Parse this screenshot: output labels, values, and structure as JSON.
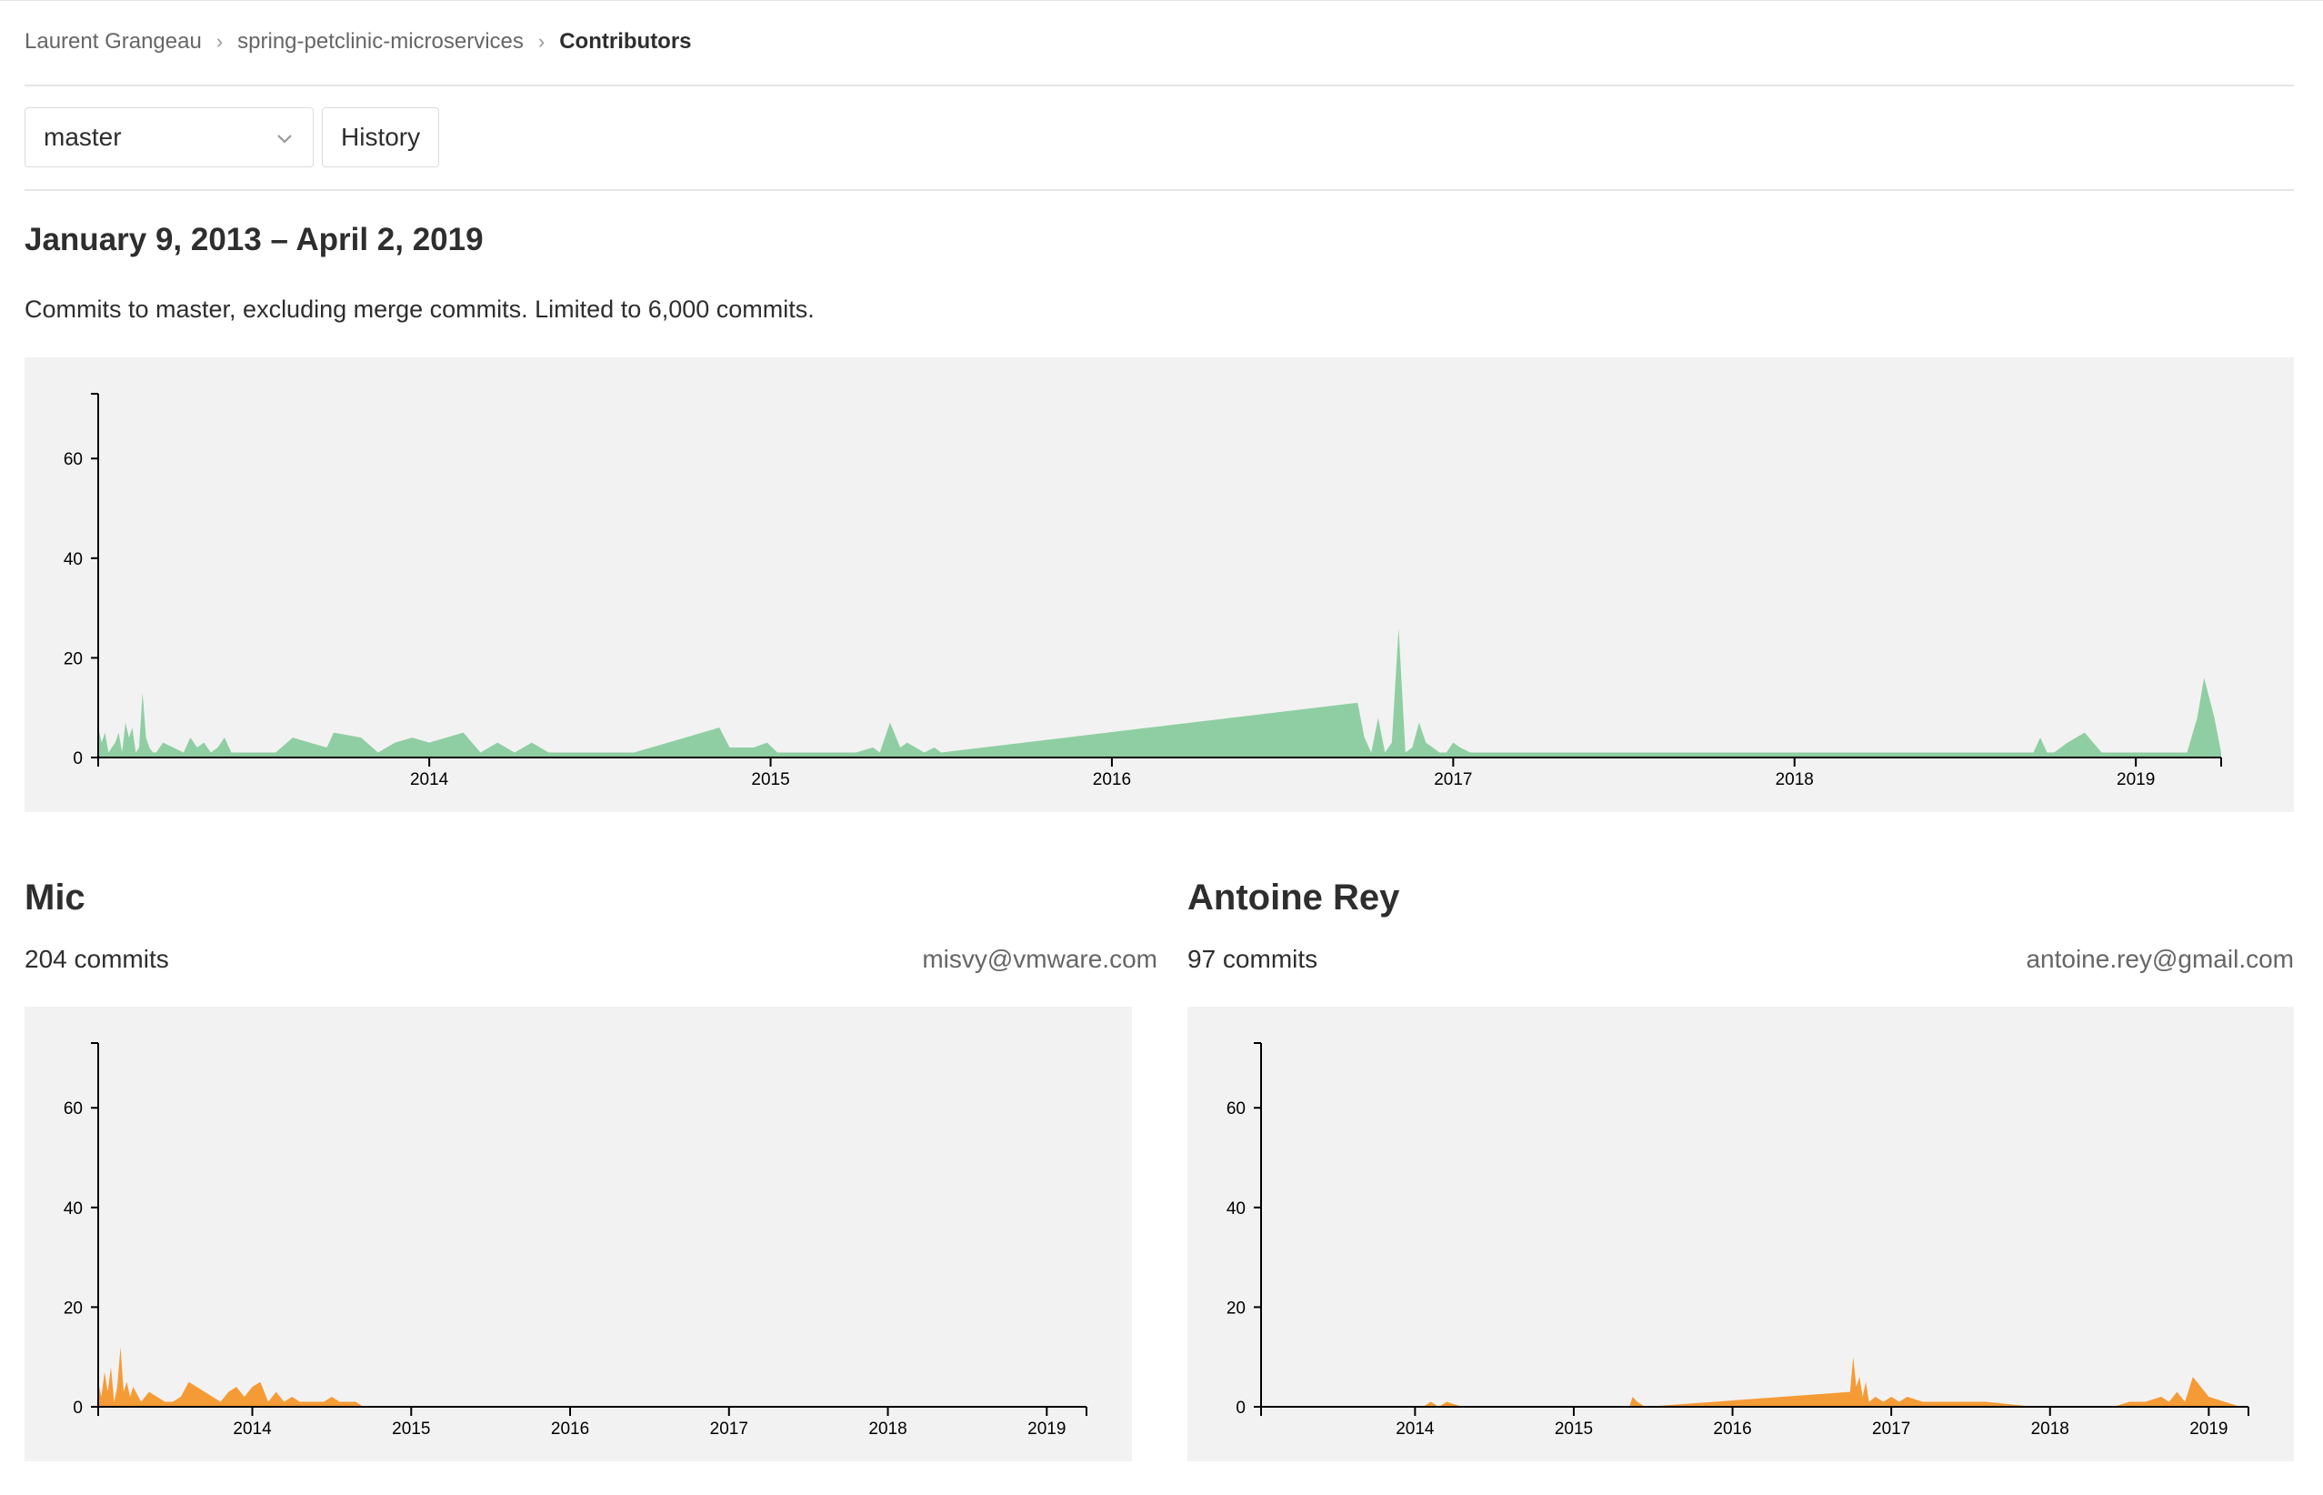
{
  "breadcrumb": {
    "items": [
      "Laurent Grangeau",
      "spring-petclinic-microservices"
    ],
    "current": "Contributors"
  },
  "controls": {
    "branch": "master",
    "history_label": "History"
  },
  "range_title": "January 9, 2013 – April 2, 2019",
  "description": "Commits to master, excluding merge commits. Limited to 6,000 commits.",
  "colors": {
    "overall": "#8fcea2",
    "contributor": "#f59b36",
    "chart_bg": "#f2f2f2"
  },
  "chart_data": [
    {
      "type": "area",
      "ylim": [
        0,
        73
      ],
      "yticks": [
        0,
        20,
        40,
        60
      ],
      "xlim": [
        2013.03,
        2019.25
      ],
      "xticks": [
        "2014",
        "2015",
        "2016",
        "2017",
        "2018",
        "2019"
      ],
      "series": [
        {
          "x": [
            2013.03,
            2013.04,
            2013.05,
            2013.06,
            2013.07,
            2013.08,
            2013.09,
            2013.1,
            2013.11,
            2013.12,
            2013.13,
            2013.14,
            2013.15,
            2013.16,
            2013.17,
            2013.18,
            2013.19,
            2013.2,
            2013.22,
            2013.25,
            2013.28,
            2013.3,
            2013.32,
            2013.34,
            2013.36,
            2013.38,
            2013.4,
            2013.42,
            2013.45,
            2013.47,
            2013.5,
            2013.55,
            2013.6,
            2013.65,
            2013.7,
            2013.72,
            2013.8,
            2013.85,
            2013.9,
            2013.95,
            2014.0,
            2014.1,
            2014.15,
            2014.2,
            2014.25,
            2014.3,
            2014.35,
            2014.4,
            2014.6,
            2014.75,
            2014.85,
            2014.88,
            2014.95,
            2014.99,
            2015.02,
            2015.05,
            2015.1,
            2015.2,
            2015.25,
            2015.3,
            2015.32,
            2015.35,
            2015.38,
            2015.4,
            2015.45,
            2015.48,
            2015.5,
            2016.72,
            2016.74,
            2016.76,
            2016.78,
            2016.8,
            2016.82,
            2016.84,
            2016.86,
            2016.88,
            2016.9,
            2016.92,
            2016.94,
            2016.96,
            2016.98,
            2017.0,
            2017.02,
            2017.05,
            2018.7,
            2018.72,
            2018.74,
            2018.76,
            2018.8,
            2018.85,
            2018.9,
            2019.05,
            2019.1,
            2019.15,
            2019.18,
            2019.2,
            2019.23,
            2019.25
          ],
          "y": [
            6,
            3,
            5,
            1,
            2,
            3,
            5,
            1,
            7,
            4,
            6,
            1,
            2,
            13,
            4,
            2,
            1,
            1,
            3,
            2,
            1,
            4,
            2,
            3,
            1,
            2,
            4,
            1,
            1,
            1,
            1,
            1,
            4,
            3,
            2,
            5,
            4,
            1,
            3,
            4,
            3,
            5,
            1,
            3,
            1,
            3,
            1,
            1,
            1,
            4,
            6,
            2,
            2,
            3,
            1,
            1,
            1,
            1,
            1,
            2,
            1,
            7,
            2,
            3,
            1,
            2,
            1,
            11,
            4,
            1,
            8,
            1,
            3,
            26,
            1,
            2,
            7,
            3,
            2,
            1,
            1,
            3,
            2,
            1,
            1,
            4,
            1,
            1,
            3,
            5,
            1,
            1,
            1,
            1,
            8,
            16,
            8,
            1
          ]
        }
      ]
    },
    {
      "type": "area",
      "title": "Mic",
      "ylim": [
        0,
        73
      ],
      "yticks": [
        0,
        20,
        40,
        60
      ],
      "xlim": [
        2013.03,
        2019.25
      ],
      "xticks": [
        "2014",
        "2015",
        "2016",
        "2017",
        "2018",
        "2019"
      ],
      "series": [
        {
          "x": [
            2013.03,
            2013.05,
            2013.07,
            2013.09,
            2013.11,
            2013.13,
            2013.15,
            2013.17,
            2013.19,
            2013.21,
            2013.23,
            2013.25,
            2013.3,
            2013.35,
            2013.4,
            2013.45,
            2013.5,
            2013.55,
            2013.6,
            2013.65,
            2013.7,
            2013.75,
            2013.8,
            2013.85,
            2013.9,
            2013.95,
            2014.0,
            2014.05,
            2014.1,
            2014.15,
            2014.2,
            2014.25,
            2014.3,
            2014.35,
            2014.4,
            2014.45,
            2014.5,
            2014.55,
            2014.6,
            2014.65,
            2014.7,
            2014.75,
            2014.8,
            2014.85,
            2014.9,
            2015.0,
            2019.25
          ],
          "y": [
            5,
            2,
            7,
            3,
            8,
            1,
            4,
            12,
            3,
            5,
            2,
            4,
            1,
            3,
            2,
            1,
            1,
            2,
            5,
            4,
            3,
            2,
            1,
            3,
            4,
            2,
            4,
            5,
            1,
            3,
            1,
            2,
            1,
            1,
            1,
            1,
            2,
            1,
            1,
            1,
            0,
            0,
            0,
            0,
            0,
            0,
            0
          ]
        }
      ]
    },
    {
      "type": "area",
      "title": "Antoine Rey",
      "ylim": [
        0,
        73
      ],
      "yticks": [
        0,
        20,
        40,
        60
      ],
      "xlim": [
        2013.03,
        2019.25
      ],
      "xticks": [
        "2014",
        "2015",
        "2016",
        "2017",
        "2018",
        "2019"
      ],
      "series": [
        {
          "x": [
            2013.03,
            2014.05,
            2014.1,
            2014.15,
            2014.2,
            2014.3,
            2015.35,
            2015.37,
            2015.4,
            2015.45,
            2016.74,
            2016.76,
            2016.78,
            2016.8,
            2016.82,
            2016.84,
            2016.86,
            2016.9,
            2016.95,
            2017.0,
            2017.05,
            2017.1,
            2017.2,
            2017.3,
            2017.4,
            2017.6,
            2017.9,
            2018.4,
            2018.5,
            2018.6,
            2018.7,
            2018.75,
            2018.8,
            2018.85,
            2018.9,
            2019.0,
            2019.1,
            2019.2,
            2019.25
          ],
          "y": [
            0,
            0,
            1,
            0,
            1,
            0,
            0,
            2,
            1,
            0,
            3,
            10,
            4,
            6,
            2,
            5,
            1,
            2,
            1,
            2,
            1,
            2,
            1,
            1,
            1,
            1,
            0,
            0,
            1,
            1,
            2,
            1,
            3,
            1,
            6,
            2,
            1,
            0,
            0
          ]
        }
      ]
    }
  ],
  "contributors": [
    {
      "name": "Mic",
      "commits": "204 commits",
      "email": "misvy@vmware.com"
    },
    {
      "name": "Antoine Rey",
      "commits": "97 commits",
      "email": "antoine.rey@gmail.com"
    }
  ]
}
